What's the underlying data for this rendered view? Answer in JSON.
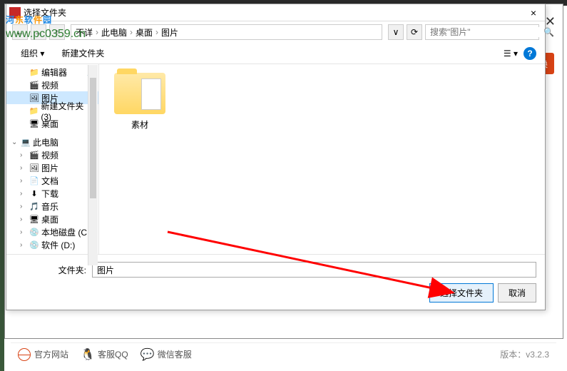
{
  "dialog": {
    "title": "选择文件夹",
    "close": "×",
    "nav": {
      "back": "←",
      "fwd": "→",
      "up": "↑",
      "refresh": "⟳",
      "dropdown": "∨"
    },
    "breadcrumb": {
      "sep": "›",
      "items": [
        "不详",
        "此电脑",
        "桌面",
        "图片"
      ]
    },
    "search": {
      "placeholder": "搜索\"图片\"",
      "icon": "🔍"
    },
    "toolbar": {
      "organize": "组织 ▾",
      "new_folder": "新建文件夹",
      "view": "☰ ▾",
      "help": "?"
    },
    "tree": {
      "items": [
        {
          "indent": 1,
          "expand": "",
          "icon": "📁",
          "label": "编辑器",
          "pin": true
        },
        {
          "indent": 1,
          "expand": "",
          "icon": "🎬",
          "label": "视频"
        },
        {
          "indent": 1,
          "expand": "",
          "icon": "🖼",
          "label": "图片",
          "selected": true
        },
        {
          "indent": 1,
          "expand": "",
          "icon": "📁",
          "label": "新建文件夹 (3)"
        },
        {
          "indent": 1,
          "expand": "",
          "icon": "🖥",
          "label": "桌面"
        },
        {
          "spacer": true
        },
        {
          "indent": 0,
          "expand": "⌄",
          "icon": "💻",
          "label": "此电脑"
        },
        {
          "indent": 1,
          "expand": "›",
          "icon": "🎬",
          "label": "视频"
        },
        {
          "indent": 1,
          "expand": "›",
          "icon": "🖼",
          "label": "图片"
        },
        {
          "indent": 1,
          "expand": "›",
          "icon": "📄",
          "label": "文档"
        },
        {
          "indent": 1,
          "expand": "›",
          "icon": "⬇",
          "label": "下载"
        },
        {
          "indent": 1,
          "expand": "›",
          "icon": "🎵",
          "label": "音乐"
        },
        {
          "indent": 1,
          "expand": "›",
          "icon": "🖥",
          "label": "桌面"
        },
        {
          "indent": 1,
          "expand": "›",
          "icon": "💿",
          "label": "本地磁盘 (C:)"
        },
        {
          "indent": 1,
          "expand": "›",
          "icon": "💿",
          "label": "软件 (D:)"
        }
      ]
    },
    "content": {
      "folder_name": "素材"
    },
    "footer": {
      "label": "文件夹:",
      "value": "图片",
      "select_btn": "选择文件夹",
      "cancel_btn": "取消"
    }
  },
  "app": {
    "close": "✕",
    "convert": "换"
  },
  "bottombar": {
    "website": "官方网站",
    "qq": "客服QQ",
    "wechat": "微信客服",
    "version": "版本：v3.2.3"
  },
  "watermark": {
    "brand": "河东软件园",
    "url": "www.pc0359.cn"
  }
}
